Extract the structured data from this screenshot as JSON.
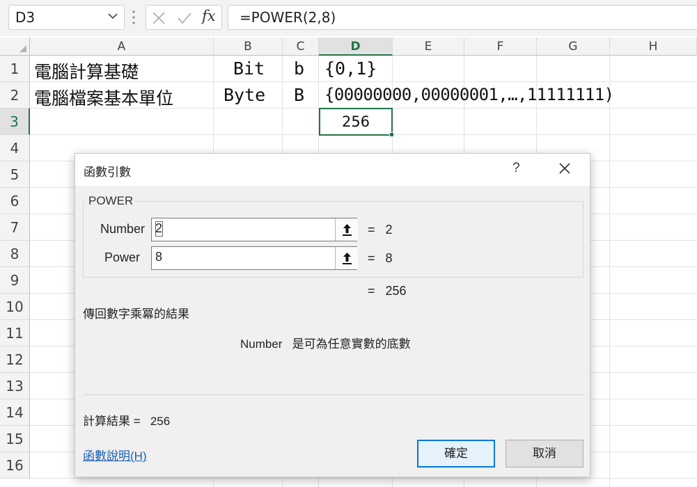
{
  "formula_bar": {
    "name_box": "D3",
    "formula": "=POWER(2,8)",
    "fx_label": "fx"
  },
  "columns": [
    "A",
    "B",
    "C",
    "D",
    "E",
    "F",
    "G",
    "H"
  ],
  "selected_column": "D",
  "rows": [
    "1",
    "2",
    "3",
    "4",
    "5",
    "6",
    "7",
    "8",
    "9",
    "10",
    "11",
    "12",
    "13",
    "14",
    "15",
    "16"
  ],
  "selected_row": "3",
  "cells": {
    "a1": "電腦計算基礎",
    "b1": "Bit",
    "c1": "b",
    "d1": "{0,1}",
    "a2": "電腦檔案基本單位",
    "b2": "Byte",
    "c2": "B",
    "d2": "{00000000,00000001,…,11111111)",
    "d3": "256"
  },
  "dialog": {
    "title": "函數引數",
    "help_glyph": "?",
    "function_name": "POWER",
    "args": [
      {
        "label": "Number",
        "value": "2",
        "result": "2"
      },
      {
        "label": "Power",
        "value": "8",
        "result": "8"
      }
    ],
    "equals": "=",
    "formula_result": "256",
    "description": "傳回數字乘冪的結果",
    "arg_desc_name": "Number",
    "arg_desc_text": "是可為任意實數的底數",
    "calc_result_label": "計算結果 =",
    "calc_result_value": "256",
    "help_link": "函數說明(H)",
    "ok_label": "確定",
    "cancel_label": "取消"
  },
  "colors": {
    "accent": "#217346",
    "primary_button_border": "#0078d7",
    "link": "#1a5fb4"
  }
}
